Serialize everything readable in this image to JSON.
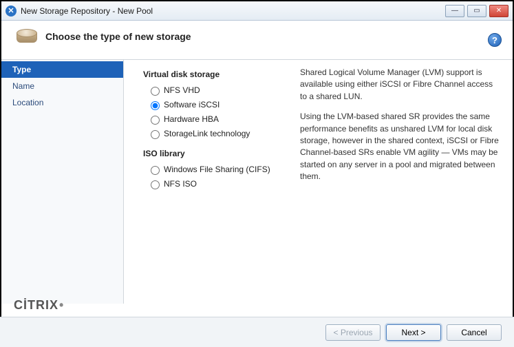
{
  "window": {
    "title": "New Storage Repository - New Pool"
  },
  "header": {
    "heading": "Choose the type of new storage"
  },
  "sidebar": {
    "steps": [
      {
        "label": "Type",
        "active": true
      },
      {
        "label": "Name",
        "active": false
      },
      {
        "label": "Location",
        "active": false
      }
    ]
  },
  "options": {
    "group1_title": "Virtual disk storage",
    "group1": [
      {
        "label": "NFS VHD",
        "selected": false
      },
      {
        "label": "Software iSCSI",
        "selected": true
      },
      {
        "label": "Hardware HBA",
        "selected": false
      },
      {
        "label": "StorageLink technology",
        "selected": false
      }
    ],
    "group2_title": "ISO library",
    "group2": [
      {
        "label": "Windows File Sharing (CIFS)",
        "selected": false
      },
      {
        "label": "NFS ISO",
        "selected": false
      }
    ]
  },
  "description": {
    "p1": "Shared Logical Volume Manager (LVM) support is available using either iSCSI or Fibre Channel access to a shared LUN.",
    "p2": "Using the LVM-based shared SR provides the same performance benefits as unshared LVM for local disk storage, however in the shared context, iSCSI or Fibre Channel-based SRs enable VM agility — VMs may be started on any server in a pool and migrated between them."
  },
  "branding": {
    "text": "CİTRIX"
  },
  "footer": {
    "previous": "< Previous",
    "next": "Next >",
    "cancel": "Cancel"
  },
  "help_glyph": "?"
}
